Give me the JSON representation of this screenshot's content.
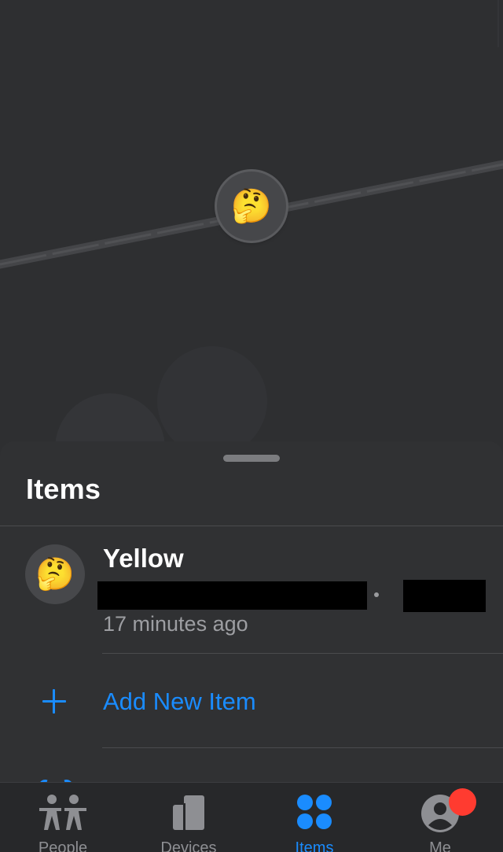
{
  "map": {
    "pin_emoji": "🤔"
  },
  "sheet": {
    "title": "Items",
    "items": [
      {
        "emoji": "🤔",
        "name": "Yellow",
        "time": "17 minutes ago"
      }
    ],
    "add_item_label": "Add New Item"
  },
  "tabbar": {
    "tabs": [
      {
        "label": "People",
        "icon": "people-icon"
      },
      {
        "label": "Devices",
        "icon": "devices-icon"
      },
      {
        "label": "Items",
        "icon": "items-icon",
        "active": true
      },
      {
        "label": "Me",
        "icon": "me-icon"
      }
    ],
    "accent_color": "#1a8cff",
    "badge_color": "#ff3b30"
  }
}
